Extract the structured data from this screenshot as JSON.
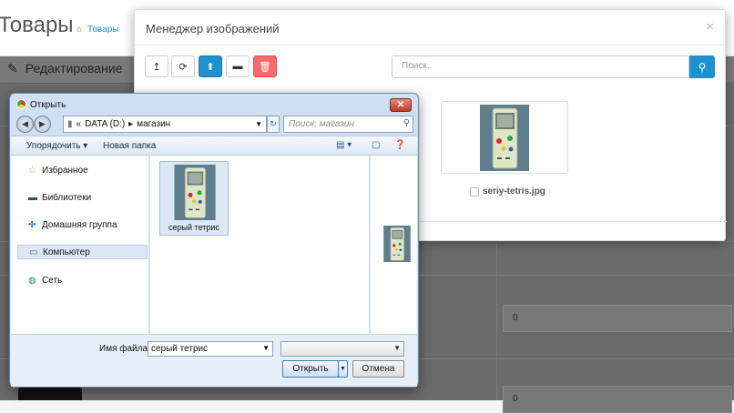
{
  "page": {
    "title": "Товары",
    "breadcrumb": "Товары",
    "section": "Редактирование",
    "field_value_1": "0",
    "field_value_2": "0"
  },
  "modal": {
    "title": "Менеджер изображений",
    "close": "×",
    "toolbar": [
      {
        "name": "parent-folder-button",
        "icon": "level-up-icon",
        "glyph": "↥"
      },
      {
        "name": "refresh-button",
        "icon": "refresh-icon",
        "glyph": "⟳"
      },
      {
        "name": "upload-button",
        "icon": "upload-icon",
        "glyph": "⬆"
      },
      {
        "name": "new-folder-button",
        "icon": "folder-icon",
        "glyph": "▬"
      },
      {
        "name": "delete-button",
        "icon": "trash-icon",
        "glyph": "🗑"
      }
    ],
    "search_placeholder": "Поиск..",
    "image": {
      "filename": "seriy-tetris.jpg"
    }
  },
  "dialog": {
    "title": "Открыть",
    "close": "✕",
    "address": [
      "«",
      "DATA (D:)",
      "▸",
      "магазин"
    ],
    "search_placeholder": "Поиск: магазин",
    "commands": {
      "organize": "Упорядочить ▾",
      "new_folder": "Новая папка"
    },
    "nav": [
      {
        "label": "Избранное",
        "icon": "star-icon",
        "glyph": "☆"
      },
      {
        "label": "Библиотеки",
        "icon": "library-icon",
        "glyph": "▬"
      },
      {
        "label": "Домашняя группа",
        "icon": "homegroup-icon",
        "glyph": "✤"
      },
      {
        "label": "Компьютер",
        "icon": "computer-icon",
        "glyph": "▭"
      },
      {
        "label": "Сеть",
        "icon": "network-icon",
        "glyph": "◍"
      }
    ],
    "file": {
      "label": "серый тетрис"
    },
    "filename_label": "Имя файла:",
    "filename_value": "серый тетрис",
    "filetype_value": "",
    "open_button": "Открыть",
    "cancel_button": "Отмена"
  },
  "colors": {
    "accent": "#1e91cf",
    "danger": "#f56b6b"
  }
}
